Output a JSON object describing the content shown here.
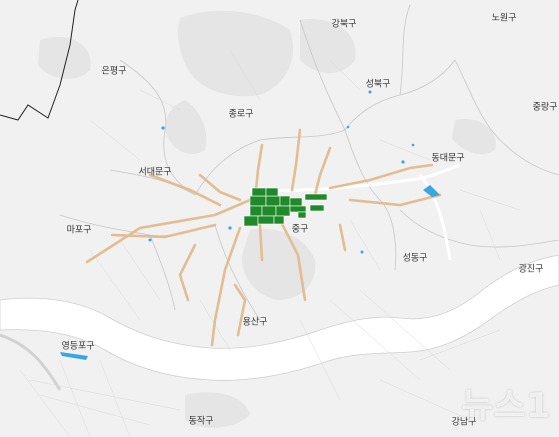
{
  "districts": [
    {
      "id": "gangbuk",
      "name": "강북구"
    },
    {
      "id": "nowon",
      "name": "노원구"
    },
    {
      "id": "eunpyeong",
      "name": "은평구"
    },
    {
      "id": "seongbuk",
      "name": "성북구"
    },
    {
      "id": "jungnang",
      "name": "중랑구"
    },
    {
      "id": "jongno",
      "name": "종로구"
    },
    {
      "id": "dongdaemun",
      "name": "동대문구"
    },
    {
      "id": "seodaemun",
      "name": "서대문구"
    },
    {
      "id": "mapo",
      "name": "마포구"
    },
    {
      "id": "junggu",
      "name": "중구"
    },
    {
      "id": "seongdong",
      "name": "성동구"
    },
    {
      "id": "gwangjin",
      "name": "광진구"
    },
    {
      "id": "yongsan",
      "name": "용산구"
    },
    {
      "id": "yeongdeungpo",
      "name": "영등포구"
    },
    {
      "id": "dongjak",
      "name": "동작구"
    },
    {
      "id": "gangnam",
      "name": "강남구"
    }
  ],
  "watermark": "뉴스1",
  "colors": {
    "background": "#f1f1f1",
    "road": "#e3bf95",
    "highlight_zone": "#1f8a2a",
    "river": "#ffffff",
    "water_marker": "#3aa7e0",
    "boundary": "#c4c4c4",
    "park": "#e6e6e6"
  }
}
